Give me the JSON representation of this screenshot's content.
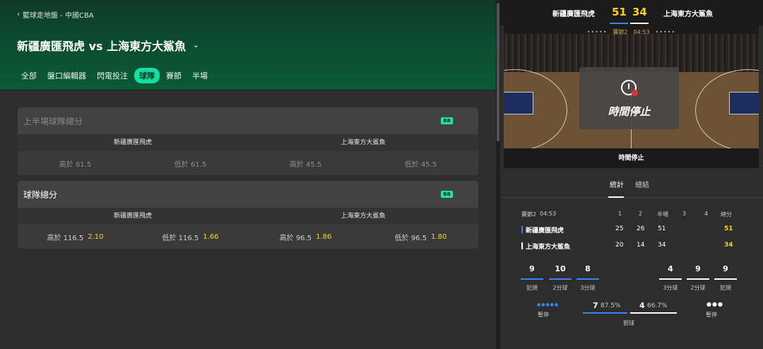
{
  "header": {
    "breadcrumb": "籃球走地盤 - 中國CBA",
    "title": "新疆廣匯飛虎 vs 上海東方大鯊魚",
    "tabs": [
      "全部",
      "盤口編輯器",
      "閃電投注",
      "球隊",
      "賽節",
      "半場"
    ]
  },
  "cards": [
    {
      "title": "上半場球隊總分",
      "badge": "BB",
      "team_home": "新疆廣匯飛虎",
      "team_away": "上海東方大鯊魚",
      "odds": [
        {
          "label": "高於 61.5",
          "price": ""
        },
        {
          "label": "低於 61.5",
          "price": ""
        },
        {
          "label": "高於 45.5",
          "price": ""
        },
        {
          "label": "低於 45.5",
          "price": ""
        }
      ]
    },
    {
      "title": "球隊總分",
      "badge": "BB",
      "team_home": "新疆廣匯飛虎",
      "team_away": "上海東方大鯊魚",
      "odds": [
        {
          "label": "高於 116.5",
          "price": "2.10"
        },
        {
          "label": "低於 116.5",
          "price": "1.66"
        },
        {
          "label": "高於 96.5",
          "price": "1.86"
        },
        {
          "label": "低於 96.5",
          "price": "1.80"
        }
      ]
    }
  ],
  "scoreboard": {
    "home": "新疆廣匯飛虎",
    "away": "上海東方大鯊魚",
    "home_score": "51",
    "away_score": "34",
    "period_info": "賽節2",
    "clock": "04:53",
    "timeout_text": "時間停止",
    "footer_text": "時間停止"
  },
  "stat_tabs": [
    "統計",
    "總結"
  ],
  "table": {
    "period": "賽節2",
    "clock": "04:53",
    "headers": [
      "1",
      "2",
      "半場",
      "3",
      "4",
      "總分"
    ],
    "rows": [
      {
        "team": "新疆廣匯飛虎",
        "q1": "25",
        "q2": "26",
        "half": "51",
        "q3": "",
        "q4": "",
        "total": "51"
      },
      {
        "team": "上海東方大鯊魚",
        "q1": "20",
        "q2": "14",
        "half": "34",
        "q3": "",
        "q4": "",
        "total": "34"
      }
    ]
  },
  "stats_home": [
    {
      "value": "9",
      "label": "犯規"
    },
    {
      "value": "10",
      "label": "2分球"
    },
    {
      "value": "8",
      "label": "3分球"
    }
  ],
  "stats_away": [
    {
      "value": "4",
      "label": "3分球"
    },
    {
      "value": "9",
      "label": "2分球"
    },
    {
      "value": "9",
      "label": "犯規"
    }
  ],
  "bottom": {
    "home_timeout_label": "暫停",
    "away_timeout_label": "暫停",
    "ft_home_value": "7",
    "ft_home_pct": "87.5%",
    "ft_away_value": "4",
    "ft_away_pct": "66.7%",
    "ft_label": "罰球"
  },
  "colors": {
    "accent": "#11e0a0",
    "price": "#f7d12a",
    "home": "#3b82f6",
    "away": "#ffffff"
  }
}
